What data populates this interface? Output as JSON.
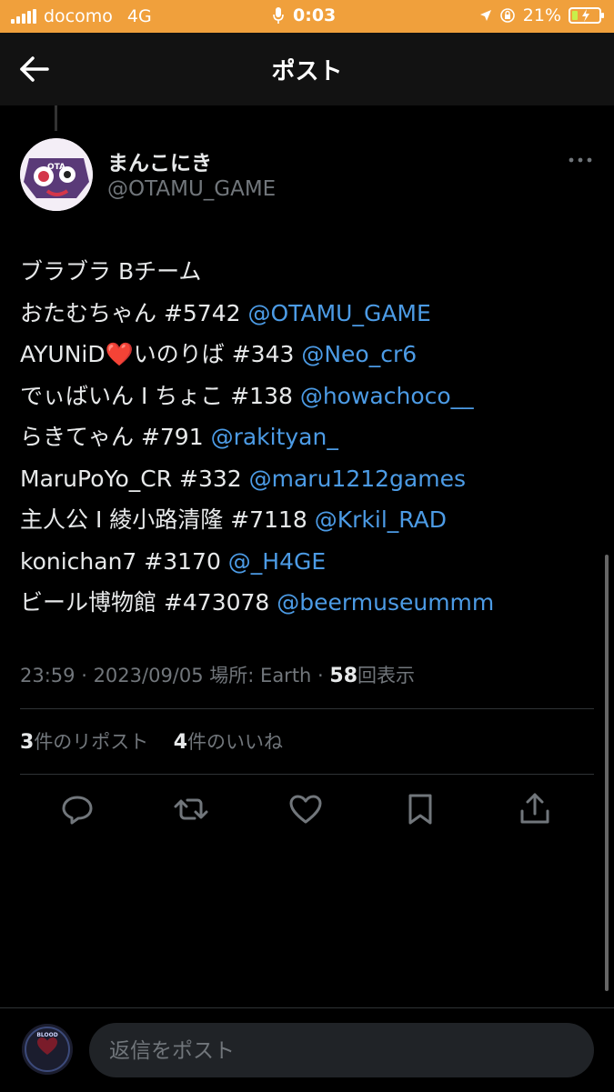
{
  "status_bar": {
    "carrier": "docomo",
    "network": "4G",
    "time": "0:03",
    "battery": "21%"
  },
  "header": {
    "title": "ポスト"
  },
  "author": {
    "name": "まんこにき",
    "handle": "@OTAMU_GAME",
    "avatar_text": "OTA"
  },
  "post_lines": [
    {
      "text": "ブラブラ Bチーム",
      "mention": ""
    },
    {
      "text": "おたむちゃん #5742 ",
      "mention": "@OTAMU_GAME"
    },
    {
      "text": "AYUNiD",
      "heart": "❤️",
      "text2": "いのりば #343 ",
      "mention": "@Neo_cr6"
    },
    {
      "text": "でぃばいん I ちょこ #138 ",
      "mention": "@howachoco__"
    },
    {
      "text": "らきてゃん #791 ",
      "mention": "@rakityan_"
    },
    {
      "text": "MaruPoYo_CR #332 ",
      "mention": "@maru1212games"
    },
    {
      "text": "主人公 I 綾小路清隆 #7118 ",
      "mention": "@Krkil_RAD"
    },
    {
      "text": "konichan7 #3170 ",
      "mention": "@_H4GE"
    },
    {
      "text": "ビール博物館 #473078 ",
      "mention": "@beermuseummm"
    }
  ],
  "meta": {
    "time": "23:59",
    "date": "2023/09/05",
    "location": "場所: Earth",
    "views_count": "58",
    "views_label": "回表示"
  },
  "stats": {
    "reposts_count": "3",
    "reposts_label": "件のリポスト",
    "likes_count": "4",
    "likes_label": "件のいいね"
  },
  "reply": {
    "placeholder": "返信をポスト",
    "avatar_text": "BLOOD"
  },
  "colors": {
    "statusbar": "#f0a03c",
    "background": "#000000",
    "link": "#4c9be5",
    "muted": "#71767b"
  },
  "icons": [
    "back-arrow-icon",
    "more-icon",
    "reply-icon",
    "repost-icon",
    "like-icon",
    "bookmark-icon",
    "share-icon"
  ]
}
